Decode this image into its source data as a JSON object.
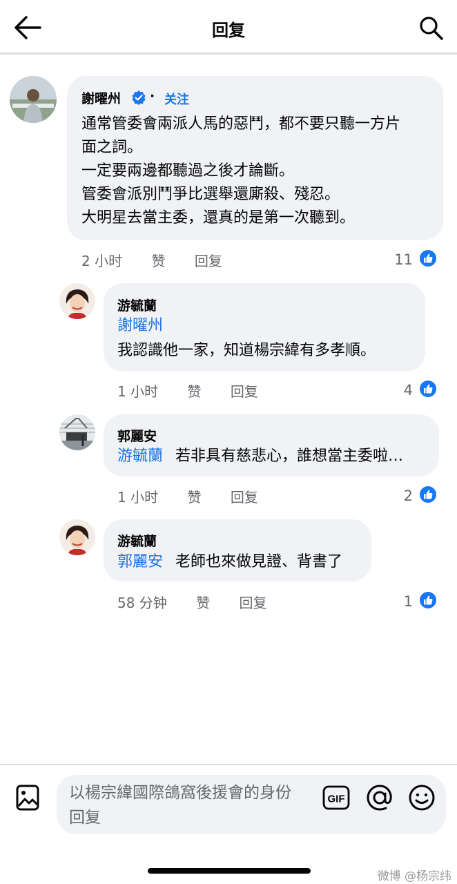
{
  "header": {
    "title": "回复"
  },
  "comments": [
    {
      "author": "謝曜州",
      "separator": "·",
      "follow_label": "关注",
      "lines": [
        "通常管委會兩派人馬的惡鬥，都不要只聽一方片",
        "面之詞。",
        "一定要兩邊都聽過之後才論斷。",
        "管委會派別鬥爭比選舉還廝殺、殘忍。",
        "大明星去當主委，還真的是第一次聽到。"
      ],
      "time": "2 小时",
      "like_label": "赞",
      "reply_label": "回复",
      "likes": "11"
    },
    {
      "author": "游毓蘭",
      "mention": "謝曜州",
      "text": "我認識他一家，知道楊宗緯有多孝順。",
      "time": "1 小时",
      "like_label": "赞",
      "reply_label": "回复",
      "likes": "4"
    },
    {
      "author": "郭麗安",
      "mention": "游毓蘭",
      "text": "若非具有慈悲心，誰想當主委啦…",
      "time": "1 小时",
      "like_label": "赞",
      "reply_label": "回复",
      "likes": "2"
    },
    {
      "author": "游毓蘭",
      "mention": "郭麗安",
      "text": "老師也來做見證、背書了",
      "time": "58 分钟",
      "like_label": "赞",
      "reply_label": "回复",
      "likes": "1"
    }
  ],
  "composer": {
    "placeholder": "以楊宗緯國際鴿窩後援會的身份回复",
    "gif_label": "GIF"
  },
  "watermark": "微博 @杨宗纬",
  "icons": [
    "back-arrow-icon",
    "search-icon",
    "verified-badge-icon",
    "like-thumb-icon",
    "photo-icon",
    "gif-icon",
    "at-sign-icon",
    "emoji-icon"
  ],
  "colors": {
    "accent": "#1b74e4",
    "bubble": "#f0f2f5",
    "like": "#1877f2",
    "meta": "#65676b"
  }
}
